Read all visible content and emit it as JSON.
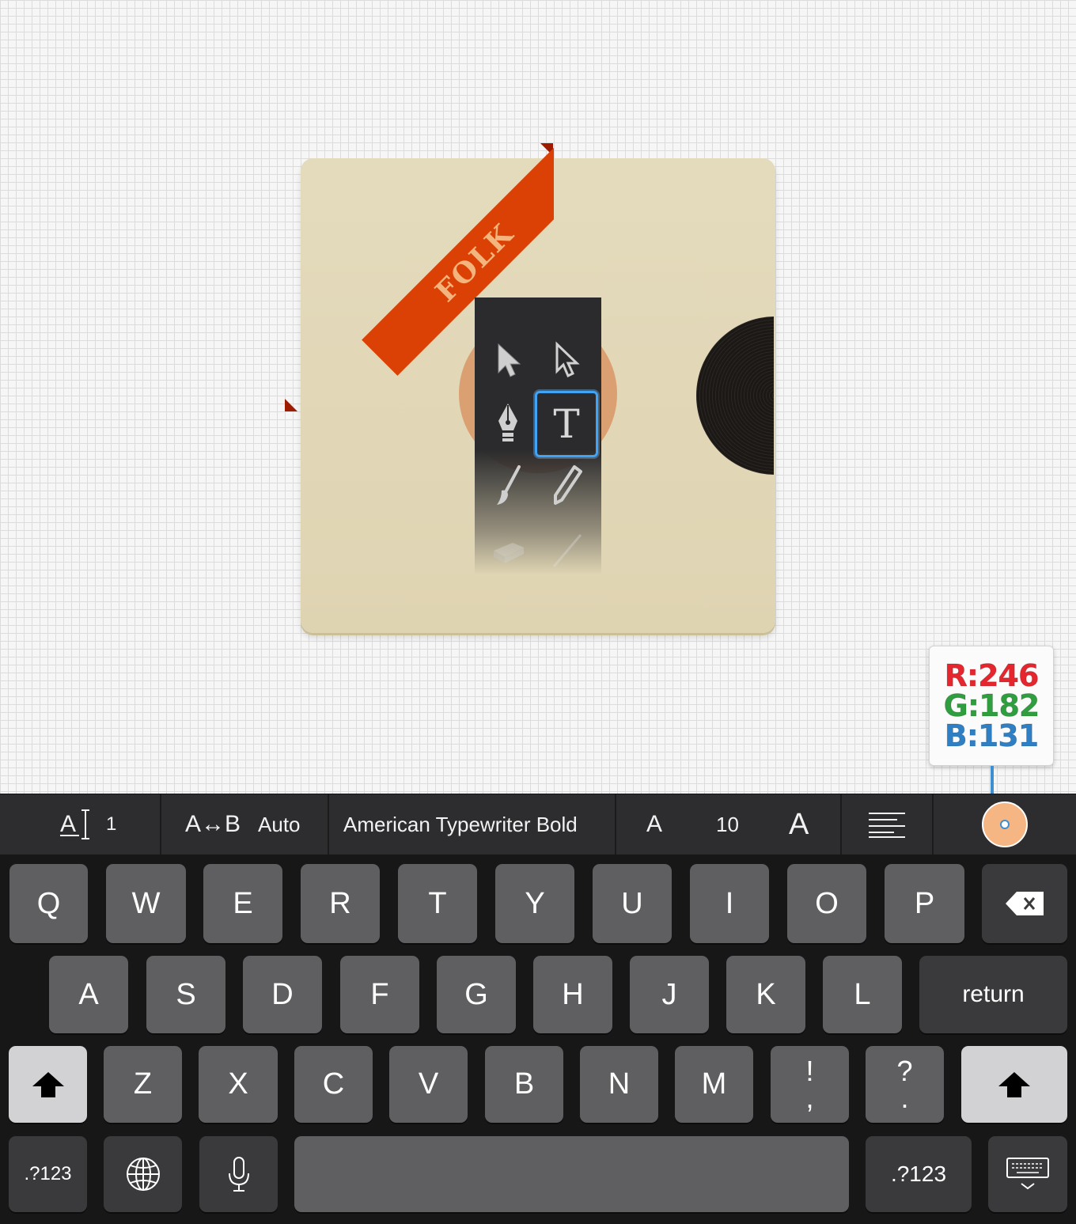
{
  "artwork": {
    "ribbon_text": "FOLK",
    "sleeve_color": "#e1d6b5",
    "ribbon_color": "#db4104",
    "label_color": "#dba072"
  },
  "tools": {
    "items": [
      "selection-tool",
      "direct-selection-tool",
      "pen-tool",
      "type-tool",
      "brush-tool",
      "pencil-tool",
      "eraser-tool",
      "line-tool"
    ],
    "active": "type-tool",
    "type_glyph": "T"
  },
  "color_readout": {
    "r": "R:246",
    "g": "G:182",
    "b": "B:131",
    "r_color": "#e5262e",
    "g_color": "#2f9e3e",
    "b_color": "#2e7fc4"
  },
  "format_bar": {
    "line_spacing_value": "1",
    "kerning_label": "A↔B",
    "kerning_value": "Auto",
    "font_name": "American Typewriter Bold",
    "size_decrease": "A",
    "font_size": "10",
    "size_increase": "A",
    "swatch_color": "#f6b683"
  },
  "keyboard": {
    "row1": [
      "Q",
      "W",
      "E",
      "R",
      "T",
      "Y",
      "U",
      "I",
      "O",
      "P"
    ],
    "row2": [
      "A",
      "S",
      "D",
      "F",
      "G",
      "H",
      "J",
      "K",
      "L"
    ],
    "return": "return",
    "row3": [
      "Z",
      "X",
      "C",
      "V",
      "B",
      "N",
      "M"
    ],
    "excl_top": "!",
    "excl_bottom": ",",
    "quest_top": "?",
    "quest_bottom": ".",
    "numbers_left": ".?123",
    "numbers_right": ".?123"
  }
}
